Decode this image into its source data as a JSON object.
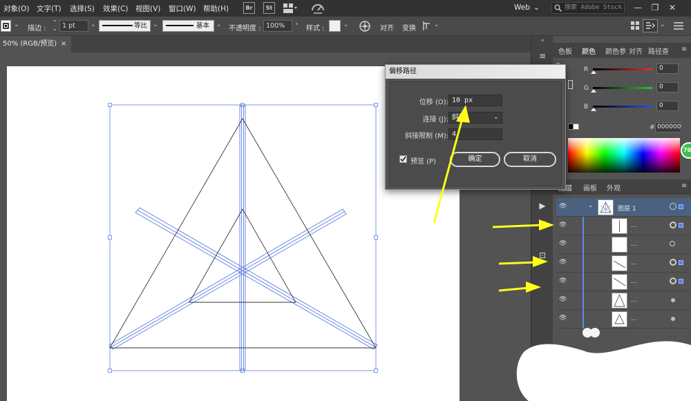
{
  "menu": {
    "items": [
      "对象(O)",
      "文字(T)",
      "选择(S)",
      "效果(C)",
      "视图(V)",
      "窗口(W)",
      "帮助(H)"
    ],
    "app_icons": [
      "Br",
      "St"
    ],
    "workspace": "Web",
    "stock_placeholder": "搜索 Adobe Stock",
    "window_controls": [
      "—",
      "❐",
      "✕"
    ]
  },
  "control": {
    "stroke_label": "描边 :",
    "stroke_weight": "1 pt",
    "profile_label": "等比",
    "brush_label": "基本",
    "opacity_label": "不透明度 :",
    "opacity_value": "100%",
    "style_label": "样式 :",
    "align_label": "对齐",
    "transform_label": "变换"
  },
  "document": {
    "tab_label": "50% (RGB/预览)",
    "tab_close": "×"
  },
  "color_panel": {
    "tabs": [
      "色板",
      "颜色",
      "颜色参",
      "对齐",
      "路径查"
    ],
    "active_tab": "颜色",
    "channels": [
      {
        "label": "R",
        "value": "0",
        "color": "#e03030"
      },
      {
        "label": "G",
        "value": "0",
        "color": "#30c040"
      },
      {
        "label": "B",
        "value": "0",
        "color": "#3050e0"
      }
    ],
    "hex_label": "#",
    "hex_value": "000000",
    "badge": "70"
  },
  "layers_panel": {
    "tabs": [
      "图层",
      "画板",
      "外观"
    ],
    "active_tab": "图层",
    "layer_name": "图层 1",
    "sublayers": [
      {
        "name": "...",
        "icon": "vertical-line"
      },
      {
        "name": "...",
        "icon": "blank"
      },
      {
        "name": "...",
        "icon": "diagonal-line"
      },
      {
        "name": "...",
        "icon": "diagonal-line"
      },
      {
        "name": "...",
        "icon": "triangle"
      },
      {
        "name": "...",
        "icon": "triangle"
      }
    ]
  },
  "dialog": {
    "title": "偏移路径",
    "offset_label": "位移 (O):",
    "offset_value": "10 px",
    "join_label": "连接 (J):",
    "join_value": "斜接",
    "miter_label": "斜接限制 (M):",
    "miter_value": "4",
    "preview_label": "预览 (P)",
    "preview_checked": true,
    "ok_label": "确定",
    "cancel_label": "取消"
  },
  "colors": {
    "accent": "#4f80ff",
    "selection": "#5b8df2",
    "annotation_arrow": "#ffff1a"
  }
}
